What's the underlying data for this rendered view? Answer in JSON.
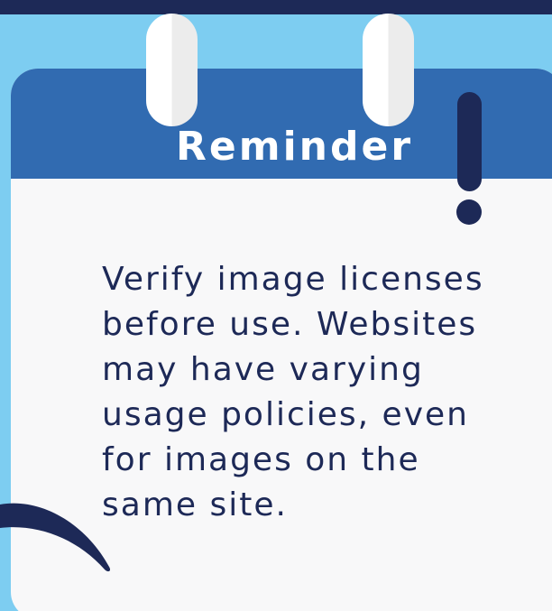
{
  "reminder_card": {
    "title": "Reminder",
    "message": "Verify image licenses\nbefore use. Websites\nmay have varying\nusage policies, even\nfor images on the\nsame site."
  },
  "colors": {
    "background": "#7dcdf1",
    "header": "#316bb1",
    "card": "#f8f8f9",
    "navy": "#1d2957"
  },
  "decorations": {
    "binder_rings": [
      "binder-ring-left",
      "binder-ring-right"
    ],
    "alert_icon": "exclamation-icon",
    "corner_shape": "swoosh-decoration"
  }
}
